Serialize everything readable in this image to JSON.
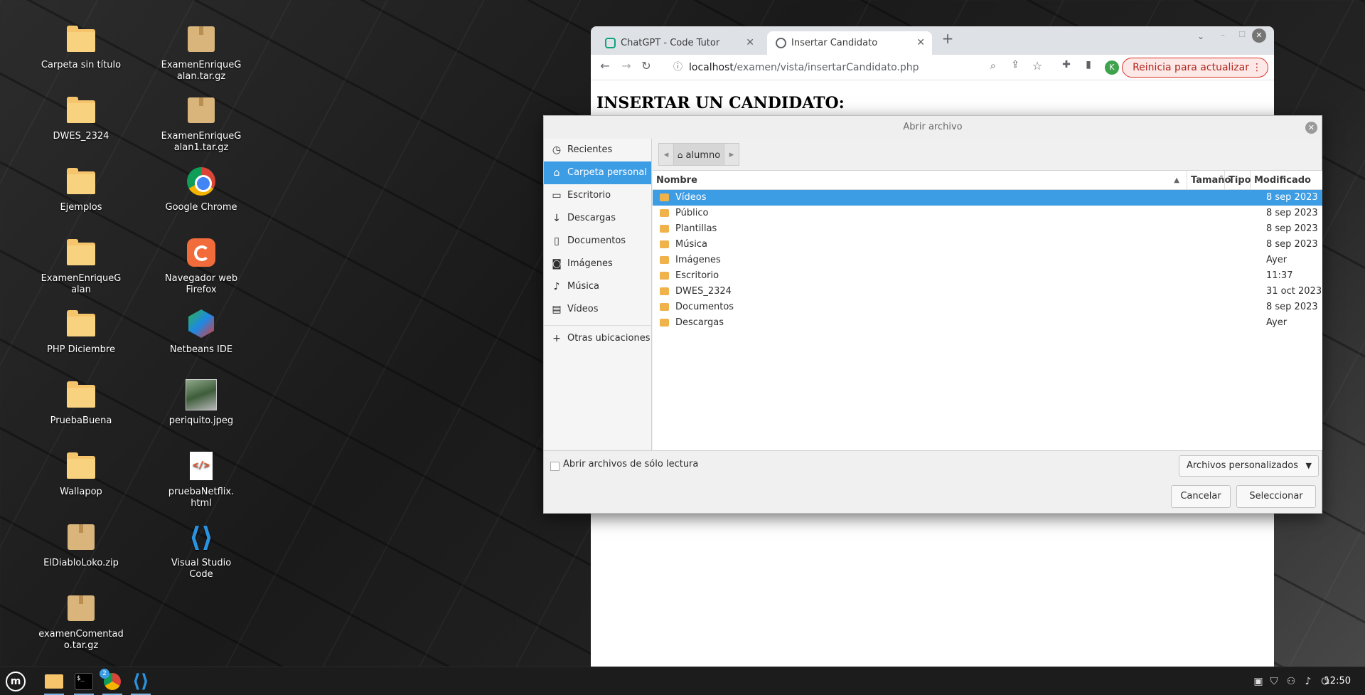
{
  "desktop": {
    "icons": [
      {
        "label": "Carpeta sin título",
        "kind": "folder-icon"
      },
      {
        "label": "DWES_2324",
        "kind": "folder-icon"
      },
      {
        "label": "Ejemplos",
        "kind": "folder-icon"
      },
      {
        "label": "ExamenEnriqueG\nalan",
        "kind": "folder-icon"
      },
      {
        "label": "PHP Diciembre",
        "kind": "folder-icon"
      },
      {
        "label": "PruebaBuena",
        "kind": "folder-icon"
      },
      {
        "label": "Wallapop",
        "kind": "folder-icon"
      },
      {
        "label": "ElDiabloLoko.zip",
        "kind": "archive-icon"
      },
      {
        "label": "examenComentad\no.tar.gz",
        "kind": "archive-icon"
      },
      {
        "label": "ExamenEnriqueG\nalan.tar.gz",
        "kind": "archive-icon"
      },
      {
        "label": "ExamenEnriqueG\nalan1.tar.gz",
        "kind": "archive-icon"
      },
      {
        "label": "Google Chrome",
        "kind": "chrome-icon"
      },
      {
        "label": "Navegador web\nFirefox",
        "kind": "firefox-icon"
      },
      {
        "label": "Netbeans IDE",
        "kind": "netbeans-icon"
      },
      {
        "label": "periquito.jpeg",
        "kind": "image-file-icon"
      },
      {
        "label": "pruebaNetflix.\nhtml",
        "kind": "html-file-icon"
      },
      {
        "label": "Visual Studio\nCode",
        "kind": "vscode-icon"
      }
    ]
  },
  "browser": {
    "tabs": [
      {
        "title": "ChatGPT - Code Tutor",
        "active": false
      },
      {
        "title": "Insertar Candidato",
        "active": true
      }
    ],
    "url_host": "localhost",
    "url_path": "/examen/vista/insertarCandidato.php",
    "update_button": "Reinicia para actualizar",
    "profile_initial": "K",
    "page_heading": "INSERTAR UN CANDIDATO:"
  },
  "dialog": {
    "title": "Abrir archivo",
    "sidebar": [
      {
        "label": "Recientes",
        "icon": "clock-icon",
        "selected": false
      },
      {
        "label": "Carpeta personal",
        "icon": "home-icon",
        "selected": true
      },
      {
        "label": "Escritorio",
        "icon": "desktop-icon",
        "selected": false
      },
      {
        "label": "Descargas",
        "icon": "download-icon",
        "selected": false
      },
      {
        "label": "Documentos",
        "icon": "document-icon",
        "selected": false
      },
      {
        "label": "Imágenes",
        "icon": "camera-icon",
        "selected": false
      },
      {
        "label": "Música",
        "icon": "music-icon",
        "selected": false
      },
      {
        "label": "Vídeos",
        "icon": "film-icon",
        "selected": false
      }
    ],
    "other_locations": "Otras ubicaciones",
    "path_current": "alumno",
    "columns": {
      "name": "Nombre",
      "size": "Tamaño",
      "type": "Tipo",
      "modified": "Modificado"
    },
    "files": [
      {
        "name": "Vídeos",
        "modified": "8 sep 2023",
        "selected": true
      },
      {
        "name": "Público",
        "modified": "8 sep 2023",
        "selected": false
      },
      {
        "name": "Plantillas",
        "modified": "8 sep 2023",
        "selected": false
      },
      {
        "name": "Música",
        "modified": "8 sep 2023",
        "selected": false
      },
      {
        "name": "Imágenes",
        "modified": "Ayer",
        "selected": false
      },
      {
        "name": "Escritorio",
        "modified": "11:37",
        "selected": false
      },
      {
        "name": "DWES_2324",
        "modified": "31 oct 2023",
        "selected": false
      },
      {
        "name": "Documentos",
        "modified": "8 sep 2023",
        "selected": false
      },
      {
        "name": "Descargas",
        "modified": "Ayer",
        "selected": false
      }
    ],
    "readonly_label": "Abrir archivos de sólo lectura",
    "filter_label": "Archivos personalizados",
    "cancel_label": "Cancelar",
    "select_label": "Seleccionar"
  },
  "taskbar": {
    "clock": "12:50",
    "chrome_badge": "2"
  },
  "colors": {
    "selection": "#3c9ce4",
    "folder": "#f5c46b",
    "update_red": "#d93025"
  }
}
